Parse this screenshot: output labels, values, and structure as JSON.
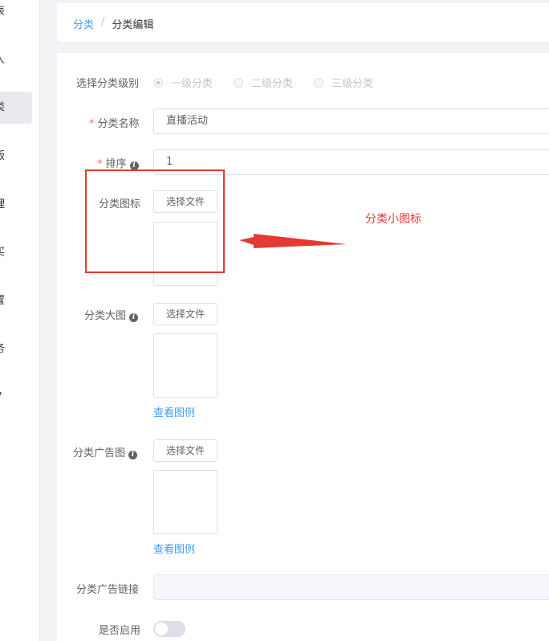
{
  "sidebar": {
    "items": [
      {
        "label": "表"
      },
      {
        "label": "人"
      },
      {
        "label": "类"
      },
      {
        "label": "版"
      },
      {
        "label": "理"
      },
      {
        "label": "买"
      },
      {
        "label": "置"
      },
      {
        "label": "务"
      },
      {
        "label": "V"
      }
    ],
    "active_index": 2
  },
  "breadcrumb": {
    "parent": "分类",
    "separator": "/",
    "current": "分类编辑"
  },
  "form": {
    "level": {
      "label": "选择分类级别",
      "options": [
        "一级分类",
        "二级分类",
        "三级分类"
      ],
      "selected": "一级分类"
    },
    "name": {
      "required_mark": "*",
      "label": "分类名称",
      "value": "直播活动"
    },
    "sort": {
      "required_mark": "*",
      "label": "排序",
      "info_icon": "i",
      "value": "1"
    },
    "icon": {
      "label": "分类图标",
      "button": "选择文件"
    },
    "big_image": {
      "label": "分类大图",
      "info_icon": "i",
      "button": "选择文件",
      "example_link": "查看图例"
    },
    "ad_image": {
      "label": "分类广告图",
      "info_icon": "i",
      "button": "选择文件",
      "example_link": "查看图例"
    },
    "ad_link": {
      "label": "分类广告链接",
      "value": ""
    },
    "enabled": {
      "label": "是否启用",
      "value": false
    }
  },
  "annotation": {
    "text": "分类小图标",
    "color": "#e53935"
  },
  "colors": {
    "link": "#409eff",
    "required": "#f56c6c",
    "annotation": "#e53935"
  }
}
